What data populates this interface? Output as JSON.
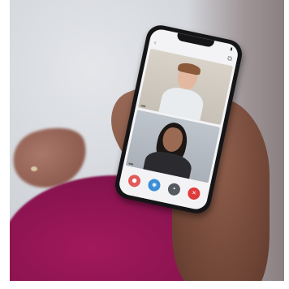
{
  "scene": {
    "colors": {
      "sweater": "#8b1450",
      "skin": "#7a4e3e",
      "phone_body": "#151517",
      "background_wall": "#d3d6db"
    }
  },
  "phone": {
    "status_bar": {
      "time": "",
      "battery_icon": "battery-icon"
    },
    "top_bar": {
      "back_icon": "chevron-left-icon",
      "share_icon": "share-icon"
    },
    "video_tiles": [
      {
        "participant_label": ""
      },
      {
        "participant_label": ""
      }
    ],
    "controls": [
      {
        "icon": "microphone-off-icon",
        "color": "#e05a5a"
      },
      {
        "icon": "camera-icon",
        "color": "#3b8ed6"
      },
      {
        "icon": "more-icon",
        "color": "#555a60"
      },
      {
        "icon": "end-call-icon",
        "color": "#e03b3b"
      }
    ]
  }
}
